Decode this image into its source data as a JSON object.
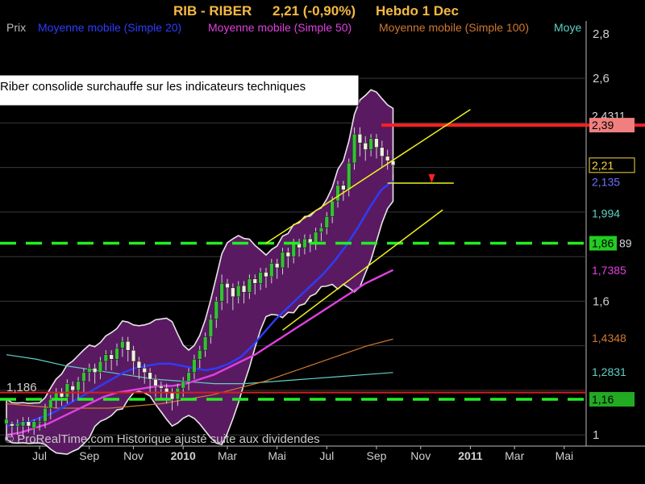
{
  "header": {
    "symbol": "RIB - RIBER",
    "price_change": "2,21 (-0,90%)",
    "period": "Hebdo  1 Dec"
  },
  "legend": [
    {
      "label": "Prix",
      "color": "#bdbdbd"
    },
    {
      "label": "Moyenne mobile (Simple 20)",
      "color": "#2d3cff"
    },
    {
      "label": "Moyenne mobile (Simple 50)",
      "color": "#e040e0"
    },
    {
      "label": "Moyenne mobile (Simple 100)",
      "color": "#d07830"
    },
    {
      "label": "Moye",
      "color": "#60d0c8"
    }
  ],
  "annotation": {
    "text": "Riber consolide surchauffe sur les indicateurs techniques"
  },
  "watermark": "© ProRealTime.com Historique ajusté suite aux dividendes",
  "colors": {
    "background": "#000000",
    "bollinger_fill": "#5a1a62",
    "bollinger_edge": "#e6e6e6",
    "candle_up": "#35c035",
    "candle_down": "#f0f0e0",
    "resistance": "#ff2020",
    "support": "#22ee22",
    "trend": "#f0f020"
  },
  "chart_data": {
    "type": "candlestick",
    "ylim": [
      0.95,
      2.85
    ],
    "y_ticks": [
      {
        "label": "2,8",
        "value": 2.8
      },
      {
        "label": "2,6",
        "value": 2.6
      },
      {
        "label": "1,6",
        "value": 1.6
      },
      {
        "label": "1",
        "value": 1.0
      }
    ],
    "x_ticks": [
      {
        "label": "Jul",
        "week": 6
      },
      {
        "label": "Sep",
        "week": 15
      },
      {
        "label": "Nov",
        "week": 23
      },
      {
        "label": "2010",
        "week": 32
      },
      {
        "label": "Mar",
        "week": 40
      },
      {
        "label": "Mai",
        "week": 49
      },
      {
        "label": "Jul",
        "week": 58
      },
      {
        "label": "Sep",
        "week": 67
      },
      {
        "label": "Nov",
        "week": 75
      },
      {
        "label": "2011",
        "week": 84
      },
      {
        "label": "Mar",
        "week": 92
      },
      {
        "label": "Mai",
        "week": 101
      }
    ],
    "price_tags": [
      {
        "label": "2,4311",
        "value": 2.4311,
        "bg": "#000000",
        "fg": "#d8d8d8"
      },
      {
        "label": "2,39",
        "value": 2.39,
        "bg": "#f08080",
        "fg": "#000000"
      },
      {
        "label": "2,21",
        "value": 2.21,
        "bg": "#000000",
        "fg": "#f5d742",
        "border": "#f5d742"
      },
      {
        "label": "2,135",
        "value": 2.135,
        "bg": "#000000",
        "fg": "#7070ff"
      },
      {
        "label": "1,994",
        "value": 1.994,
        "bg": "#000000",
        "fg": "#60d0c8"
      },
      {
        "label": "1,86",
        "value": 1.86,
        "bg": "#22cc22",
        "fg": "#000000"
      },
      {
        "label": "89",
        "value": 1.86,
        "bg": "#000000",
        "fg": "#d8d8d8"
      },
      {
        "label": "1,7385",
        "value": 1.7385,
        "bg": "#000000",
        "fg": "#e040e0"
      },
      {
        "label": "1,4348",
        "value": 1.4348,
        "bg": "#000000",
        "fg": "#d07830"
      },
      {
        "label": "1,2831",
        "value": 1.2831,
        "bg": "#000000",
        "fg": "#60d0c8"
      },
      {
        "label": "1,16",
        "value": 1.16,
        "bg": "#22aa22",
        "fg": "#000000"
      }
    ],
    "left_label": {
      "label": "1,186",
      "value": 1.186
    },
    "levels": {
      "resistance": 2.39,
      "support_high": 1.86,
      "support_low": 1.16
    },
    "candles": [
      [
        1.05,
        1.07,
        1.03,
        1.0
      ],
      [
        1.05,
        1.04,
        1.02,
        1.0
      ],
      [
        1.04,
        1.05,
        1.02,
        1.01
      ],
      [
        1.04,
        1.06,
        1.02,
        1.0
      ],
      [
        1.06,
        1.04,
        1.03,
        1.02
      ],
      [
        1.03,
        1.06,
        1.02,
        1.01
      ],
      [
        1.06,
        1.06,
        1.04,
        1.03
      ],
      [
        1.06,
        1.12,
        1.05,
        1.04
      ],
      [
        1.12,
        1.16,
        1.1,
        1.08
      ],
      [
        1.16,
        1.19,
        1.14,
        1.13
      ],
      [
        1.19,
        1.17,
        1.15,
        1.14
      ],
      [
        1.17,
        1.23,
        1.16,
        1.15
      ],
      [
        1.22,
        1.2,
        1.18,
        1.16
      ],
      [
        1.2,
        1.24,
        1.19,
        1.17
      ],
      [
        1.24,
        1.28,
        1.22,
        1.2
      ],
      [
        1.28,
        1.3,
        1.26,
        1.25
      ],
      [
        1.3,
        1.28,
        1.25,
        1.24
      ],
      [
        1.28,
        1.33,
        1.27,
        1.26
      ],
      [
        1.33,
        1.36,
        1.31,
        1.3
      ],
      [
        1.36,
        1.34,
        1.31,
        1.3
      ],
      [
        1.34,
        1.39,
        1.33,
        1.32
      ],
      [
        1.39,
        1.42,
        1.37,
        1.36
      ],
      [
        1.42,
        1.38,
        1.35,
        1.34
      ],
      [
        1.38,
        1.33,
        1.3,
        1.28
      ],
      [
        1.33,
        1.3,
        1.27,
        1.26
      ],
      [
        1.3,
        1.28,
        1.25,
        1.24
      ],
      [
        1.28,
        1.25,
        1.22,
        1.2
      ],
      [
        1.25,
        1.22,
        1.2,
        1.18
      ],
      [
        1.22,
        1.21,
        1.18,
        1.17
      ],
      [
        1.21,
        1.19,
        1.16,
        1.15
      ],
      [
        1.19,
        1.16,
        1.14,
        1.12
      ],
      [
        1.16,
        1.21,
        1.15,
        1.14
      ],
      [
        1.21,
        1.24,
        1.19,
        1.18
      ],
      [
        1.24,
        1.28,
        1.22,
        1.21
      ],
      [
        1.28,
        1.34,
        1.27,
        1.26
      ],
      [
        1.34,
        1.38,
        1.32,
        1.31
      ],
      [
        1.38,
        1.44,
        1.37,
        1.36
      ],
      [
        1.44,
        1.52,
        1.43,
        1.42
      ],
      [
        1.52,
        1.6,
        1.5,
        1.49
      ],
      [
        1.6,
        1.68,
        1.58,
        1.57
      ],
      [
        1.68,
        1.66,
        1.62,
        1.6
      ],
      [
        1.66,
        1.62,
        1.59,
        1.57
      ],
      [
        1.62,
        1.67,
        1.61,
        1.6
      ],
      [
        1.67,
        1.64,
        1.61,
        1.6
      ],
      [
        1.64,
        1.7,
        1.63,
        1.62
      ],
      [
        1.7,
        1.68,
        1.65,
        1.64
      ],
      [
        1.68,
        1.73,
        1.67,
        1.66
      ],
      [
        1.73,
        1.71,
        1.68,
        1.67
      ],
      [
        1.71,
        1.77,
        1.7,
        1.69
      ],
      [
        1.77,
        1.75,
        1.72,
        1.71
      ],
      [
        1.75,
        1.82,
        1.74,
        1.73
      ],
      [
        1.82,
        1.8,
        1.78,
        1.76
      ],
      [
        1.8,
        1.86,
        1.79,
        1.78
      ],
      [
        1.86,
        1.84,
        1.82,
        1.81
      ],
      [
        1.84,
        1.88,
        1.83,
        1.82
      ],
      [
        1.88,
        1.86,
        1.84,
        1.83
      ],
      [
        1.86,
        1.91,
        1.85,
        1.84
      ],
      [
        1.91,
        1.93,
        1.89,
        1.88
      ],
      [
        1.93,
        1.98,
        1.92,
        1.91
      ],
      [
        1.98,
        2.05,
        1.97,
        1.96
      ],
      [
        2.05,
        2.12,
        2.04,
        2.03
      ],
      [
        2.12,
        2.1,
        2.07,
        2.06
      ],
      [
        2.1,
        2.22,
        2.09,
        2.08
      ],
      [
        2.22,
        2.35,
        2.21,
        2.2
      ],
      [
        2.35,
        2.31,
        2.27,
        2.26
      ],
      [
        2.31,
        2.28,
        2.25,
        2.24
      ],
      [
        2.28,
        2.33,
        2.27,
        2.26
      ],
      [
        2.33,
        2.29,
        2.26,
        2.25
      ],
      [
        2.29,
        2.25,
        2.22,
        2.21
      ],
      [
        2.25,
        2.23,
        2.21,
        2.2
      ],
      [
        2.23,
        2.21,
        2.19,
        2.18
      ]
    ],
    "wicks": [
      [
        1.08,
        0.99
      ],
      [
        1.06,
        0.99
      ],
      [
        1.07,
        1.0
      ],
      [
        1.08,
        0.99
      ],
      [
        1.08,
        1.01
      ],
      [
        1.07,
        1.0
      ],
      [
        1.08,
        1.02
      ],
      [
        1.14,
        1.03
      ],
      [
        1.18,
        1.07
      ],
      [
        1.21,
        1.12
      ],
      [
        1.21,
        1.13
      ],
      [
        1.25,
        1.14
      ],
      [
        1.24,
        1.15
      ],
      [
        1.26,
        1.16
      ],
      [
        1.3,
        1.19
      ],
      [
        1.32,
        1.24
      ],
      [
        1.32,
        1.23
      ],
      [
        1.35,
        1.25
      ],
      [
        1.38,
        1.29
      ],
      [
        1.38,
        1.29
      ],
      [
        1.41,
        1.31
      ],
      [
        1.44,
        1.35
      ],
      [
        1.44,
        1.33
      ],
      [
        1.4,
        1.27
      ],
      [
        1.35,
        1.25
      ],
      [
        1.32,
        1.23
      ],
      [
        1.3,
        1.19
      ],
      [
        1.27,
        1.17
      ],
      [
        1.24,
        1.16
      ],
      [
        1.23,
        1.14
      ],
      [
        1.21,
        1.11
      ],
      [
        1.23,
        1.13
      ],
      [
        1.26,
        1.17
      ],
      [
        1.3,
        1.2
      ],
      [
        1.36,
        1.25
      ],
      [
        1.4,
        1.3
      ],
      [
        1.46,
        1.35
      ],
      [
        1.54,
        1.41
      ],
      [
        1.62,
        1.48
      ],
      [
        1.72,
        1.56
      ],
      [
        1.7,
        1.59
      ],
      [
        1.68,
        1.56
      ],
      [
        1.69,
        1.59
      ],
      [
        1.69,
        1.59
      ],
      [
        1.72,
        1.61
      ],
      [
        1.72,
        1.63
      ],
      [
        1.75,
        1.65
      ],
      [
        1.75,
        1.66
      ],
      [
        1.79,
        1.68
      ],
      [
        1.79,
        1.7
      ],
      [
        1.84,
        1.72
      ],
      [
        1.84,
        1.75
      ],
      [
        1.88,
        1.77
      ],
      [
        1.88,
        1.8
      ],
      [
        1.9,
        1.81
      ],
      [
        1.9,
        1.82
      ],
      [
        1.93,
        1.83
      ],
      [
        1.95,
        1.87
      ],
      [
        2.0,
        1.9
      ],
      [
        2.07,
        1.95
      ],
      [
        2.14,
        2.02
      ],
      [
        2.14,
        2.05
      ],
      [
        2.24,
        2.07
      ],
      [
        2.38,
        2.19
      ],
      [
        2.38,
        2.25
      ],
      [
        2.34,
        2.23
      ],
      [
        2.35,
        2.25
      ],
      [
        2.35,
        2.24
      ],
      [
        2.32,
        2.2
      ],
      [
        2.28,
        2.19
      ],
      [
        2.26,
        2.17
      ]
    ],
    "ma20": [
      1.04,
      1.05,
      1.06,
      1.08,
      1.1,
      1.13,
      1.16,
      1.19,
      1.22,
      1.25,
      1.28,
      1.3,
      1.31,
      1.32,
      1.32,
      1.31,
      1.3,
      1.29,
      1.3,
      1.32,
      1.35,
      1.4,
      1.46,
      1.52,
      1.57,
      1.62,
      1.67,
      1.72,
      1.78,
      1.85,
      1.93,
      2.02,
      2.1,
      2.14
    ],
    "ma50": [
      1.0,
      1.01,
      1.03,
      1.05,
      1.08,
      1.11,
      1.14,
      1.17,
      1.19,
      1.2,
      1.21,
      1.22,
      1.22,
      1.23,
      1.25,
      1.27,
      1.3,
      1.33,
      1.36,
      1.4,
      1.44,
      1.48,
      1.52,
      1.56,
      1.6,
      1.64,
      1.68,
      1.71,
      1.74
    ],
    "ma100": [
      1.14,
      1.13,
      1.12,
      1.12,
      1.12,
      1.13,
      1.14,
      1.16,
      1.18,
      1.21,
      1.24,
      1.28,
      1.32,
      1.36,
      1.4,
      1.43
    ],
    "ma200": [
      1.36,
      1.34,
      1.31,
      1.29,
      1.27,
      1.25,
      1.24,
      1.23,
      1.23,
      1.24,
      1.25,
      1.26,
      1.27,
      1.28
    ]
  }
}
